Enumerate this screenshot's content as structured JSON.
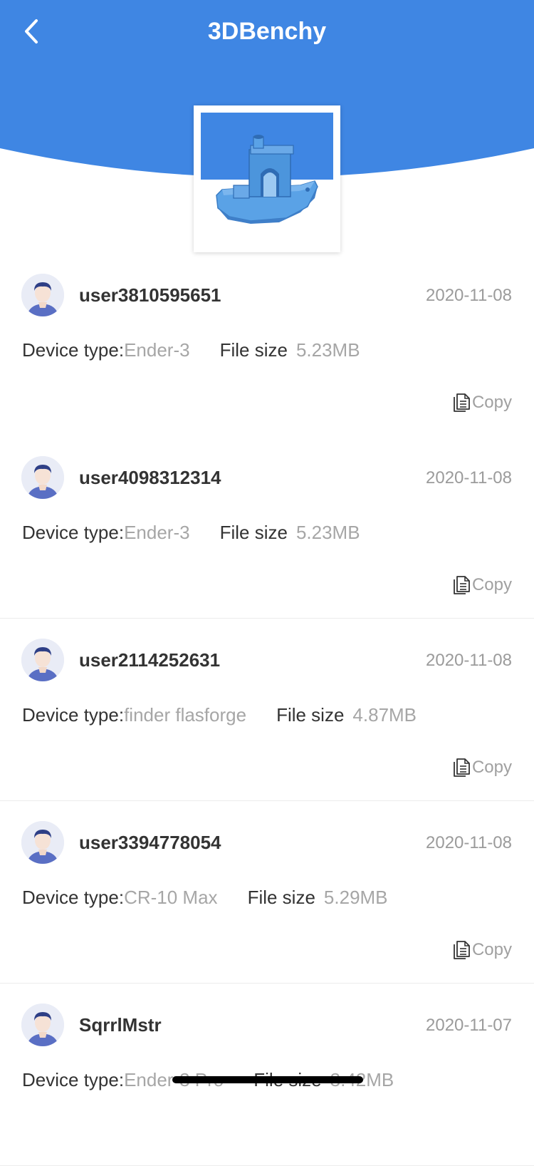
{
  "header": {
    "title": "3DBenchy",
    "back_icon": "chevron-left-icon",
    "color": "#3f86e3"
  },
  "model": {
    "thumbnail_icon": "3d-benchy-boat-image"
  },
  "labels": {
    "device_type": "Device type:",
    "file_size": "File size",
    "copy": "Copy"
  },
  "records": [
    {
      "username": "user3810595651",
      "date": "2020-11-08",
      "device_type": "Ender-3",
      "file_size": "5.23MB"
    },
    {
      "username": "user4098312314",
      "date": "2020-11-08",
      "device_type": "Ender-3",
      "file_size": "5.23MB"
    },
    {
      "username": "user2114252631",
      "date": "2020-11-08",
      "device_type": "finder flasforge",
      "file_size": "4.87MB"
    },
    {
      "username": "user3394778054",
      "date": "2020-11-08",
      "device_type": "CR-10 Max",
      "file_size": "5.29MB"
    },
    {
      "username": "SqrrlMstr",
      "date": "2020-11-07",
      "device_type": "Ender-3 Pro",
      "file_size": "3.42MB"
    }
  ]
}
